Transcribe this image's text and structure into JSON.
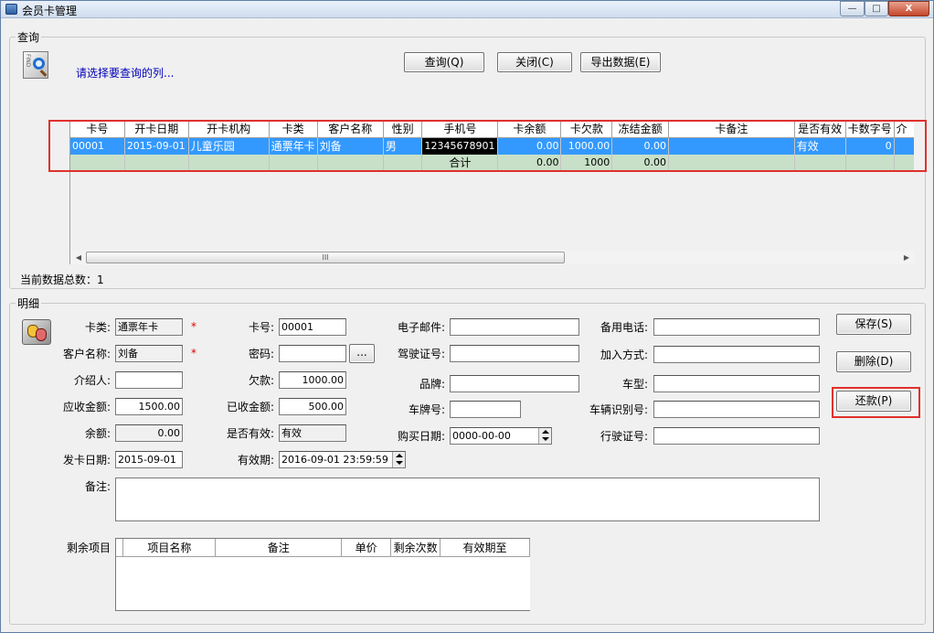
{
  "window": {
    "title": "会员卡管理",
    "controls": {
      "minimize": "—",
      "maximize": "□",
      "close": "X"
    }
  },
  "query_group": {
    "legend": "查询",
    "icon": "find-icon",
    "hint": "请选择要查询的列...",
    "buttons": {
      "query": "查询(Q)",
      "close": "关闭(C)",
      "export": "导出数据(E)"
    }
  },
  "grid": {
    "columns": [
      "卡号",
      "开卡日期",
      "开卡机构",
      "卡类",
      "客户名称",
      "性别",
      "手机号",
      "卡余额",
      "卡欠款",
      "冻结金额",
      "卡备注",
      "是否有效",
      "卡数字号",
      "介"
    ],
    "rows": [
      {
        "card_no": "00001",
        "open_date": "2015-09-01",
        "org": "儿童乐园",
        "type": "通票年卡",
        "customer": "刘备",
        "gender": "男",
        "phone": "12345678901",
        "balance": "0.00",
        "debt": "1000.00",
        "frozen": "0.00",
        "remark": "",
        "valid": "有效",
        "digit_no": "0",
        "extra": ""
      }
    ],
    "summary": {
      "label": "合计",
      "balance": "0.00",
      "debt": "1000",
      "frozen": "0.00"
    },
    "scroll_thumb": "III"
  },
  "record_count": "当前数据总数：1",
  "detail_group": {
    "legend": "明细",
    "fields": {
      "card_type": {
        "label": "卡类:",
        "value": "通票年卡"
      },
      "customer_name": {
        "label": "客户名称:",
        "value": "刘备"
      },
      "introducer": {
        "label": "介绍人:",
        "value": ""
      },
      "receivable": {
        "label": "应收金额:",
        "value": "1500.00"
      },
      "balance": {
        "label": "余额:",
        "value": "0.00"
      },
      "issue_date": {
        "label": "发卡日期:",
        "value": "2015-09-01"
      },
      "remark": {
        "label": "备注:",
        "value": ""
      },
      "card_no": {
        "label": "卡号:",
        "value": "00001"
      },
      "password": {
        "label": "密码:",
        "value": "",
        "browse": "..."
      },
      "debt": {
        "label": "欠款:",
        "value": "1000.00"
      },
      "received": {
        "label": "已收金额:",
        "value": "500.00"
      },
      "is_valid": {
        "label": "是否有效:",
        "value": "有效"
      },
      "valid_until": {
        "label": "有效期:",
        "value": "2016-09-01  23:59:59"
      },
      "email": {
        "label": "电子邮件:",
        "value": ""
      },
      "license_no": {
        "label": "驾驶证号:",
        "value": ""
      },
      "brand": {
        "label": "品牌:",
        "value": ""
      },
      "plate_no": {
        "label": "车牌号:",
        "value": ""
      },
      "purchase_date": {
        "label": "购买日期:",
        "value": "0000-00-00"
      },
      "backup_phone": {
        "label": "备用电话:",
        "value": ""
      },
      "join_method": {
        "label": "加入方式:",
        "value": ""
      },
      "car_model": {
        "label": "车型:",
        "value": ""
      },
      "vin": {
        "label": "车辆识别号:",
        "value": ""
      },
      "driving_permit": {
        "label": "行驶证号:",
        "value": ""
      }
    },
    "required_mark": "*",
    "buttons": {
      "save": "保存(S)",
      "delete": "删除(D)",
      "repay": "还款(P)"
    },
    "remaining": {
      "label": "剩余项目",
      "columns": [
        "项目名称",
        "备注",
        "单价",
        "剩余次数",
        "有效期至"
      ]
    }
  },
  "colors": {
    "selection": "#3399ff",
    "summary_row": "#c8e0c8",
    "highlight_box": "#e0312c",
    "hint_text": "#0000b8"
  }
}
